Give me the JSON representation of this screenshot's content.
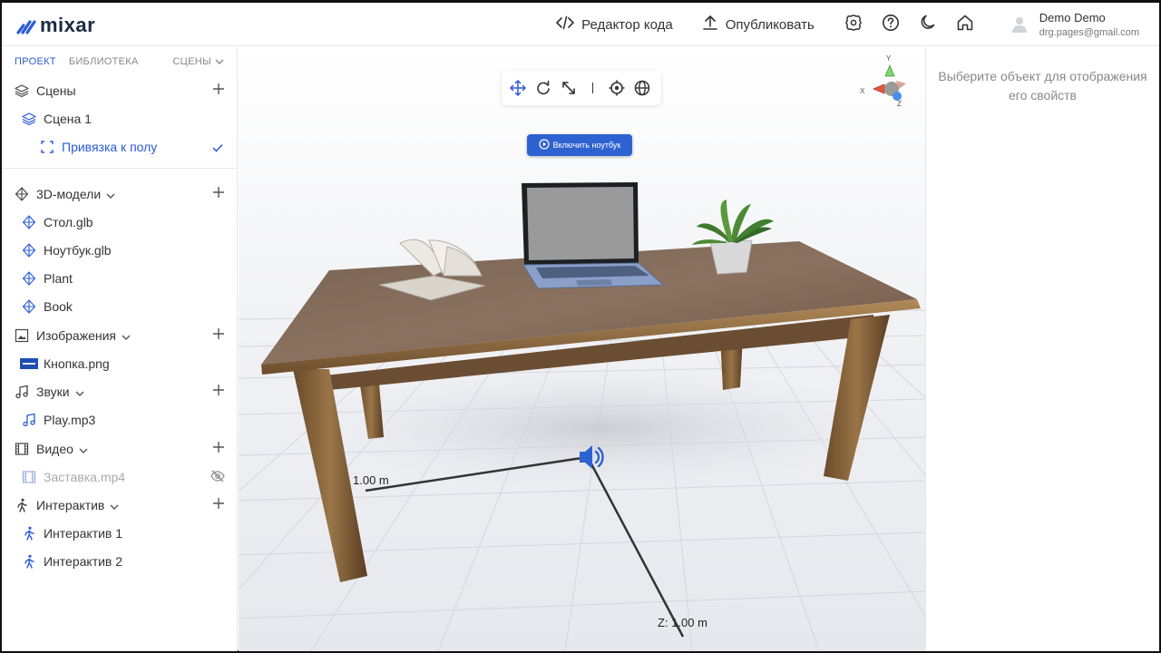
{
  "app": {
    "logo_text": "mixar"
  },
  "header": {
    "code_editor_label": "Редактор кода",
    "publish_label": "Опубликовать",
    "user_name": "Demo Demo",
    "user_email": "drg.pages@gmail.com"
  },
  "sidebar": {
    "tabs": {
      "project": "ПРОЕКТ",
      "library": "БИБЛИОТЕКА",
      "scenes": "СЦЕНЫ"
    },
    "scenes_header": "Сцены",
    "scene_1": "Сцена 1",
    "floor_snap": "Привязка к полу",
    "models_header": "3D-модели",
    "models": [
      "Стол.glb",
      "Ноутбук.glb",
      "Plant",
      "Book"
    ],
    "images_header": "Изображения",
    "images": [
      "Кнопка.png"
    ],
    "sounds_header": "Звуки",
    "sounds": [
      "Play.mp3"
    ],
    "video_header": "Видео",
    "videos": [
      "Заставка.mp4"
    ],
    "interactive_header": "Интерактив",
    "interactives": [
      "Интерактив 1",
      "Интерактив 2"
    ]
  },
  "viewport": {
    "play_button_label": "Включить ноутбук",
    "dim_x_label": "1.00 m",
    "dim_z_label": "Z: 1.00 m",
    "axis_x": "X",
    "axis_y": "Y",
    "axis_z": "Z"
  },
  "properties": {
    "empty_text": "Выберите объект для отображения его свойств"
  },
  "colors": {
    "accent": "#2a5bd7",
    "button": "#2f62d1",
    "text": "#333333"
  }
}
